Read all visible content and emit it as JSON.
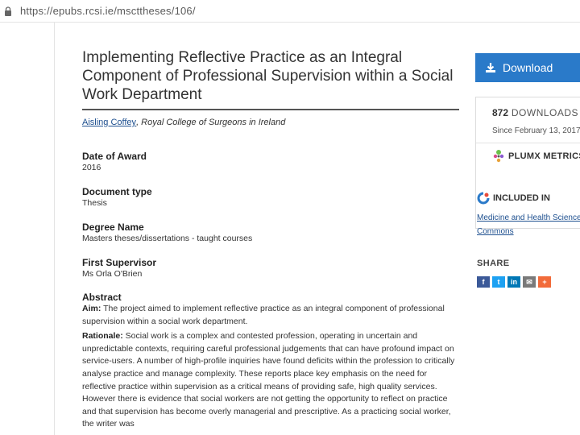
{
  "browser": {
    "url": "https://epubs.rcsi.ie/mscttheses/106/"
  },
  "article": {
    "title": "Implementing Reflective Practice as an Integral Component of Professional Supervision within a Social Work Department",
    "author": "Aisling Coffey",
    "affiliation": ", Royal College of Surgeons in Ireland",
    "fields": [
      {
        "label": "Date of Award",
        "value": "2016"
      },
      {
        "label": "Document type",
        "value": "Thesis"
      },
      {
        "label": "Degree Name",
        "value": "Masters theses/dissertations - taught courses"
      },
      {
        "label": "First Supervisor",
        "value": "Ms Orla O'Brien"
      }
    ],
    "abstract": {
      "label": "Abstract",
      "aim_label": "Aim:",
      "aim_text": " The project aimed to implement reflective practice as an integral component of professional supervision within a social work department.",
      "rationale_label": "Rationale:",
      "rationale_text": " Social work is a complex and contested profession, operating in uncertain and unpredictable contexts, requiring careful professional judgements that can have profound impact on service-users. A number of high-profile inquiries have found deficits within the profession to critically analyse practice and manage complexity. These reports place key emphasis on the need for reflective practice within supervision as a critical means of providing safe, high quality services. However there is evidence that social workers are not getting the opportunity to reflect on practice and that supervision has become overly managerial and prescriptive. As a practicing social worker, the writer was"
    }
  },
  "sidebar": {
    "download_label": "Download",
    "download_count": "872",
    "downloads_label": "DOWNLOADS",
    "since_text": "Since February 13, 2017",
    "plumx_label": "PLUMX METRICS",
    "included_label": "INCLUDED IN",
    "included_links": [
      "Medicine and Health Sciences Commons",
      "Commons"
    ],
    "included_first_line": "Medicine and Health Sciences",
    "share_label": "SHARE",
    "share_icons": [
      {
        "name": "facebook-icon",
        "glyph": "f",
        "color": "#3b5998"
      },
      {
        "name": "twitter-icon",
        "glyph": "t",
        "color": "#1da1f2"
      },
      {
        "name": "linkedin-icon",
        "glyph": "in",
        "color": "#0077b5"
      },
      {
        "name": "email-icon",
        "glyph": "✉",
        "color": "#7a7a7a"
      },
      {
        "name": "more-share-icon",
        "glyph": "+",
        "color": "#f26b3a"
      }
    ]
  },
  "colors": {
    "accent": "#2a7ac9",
    "link": "#1d4f8f"
  }
}
